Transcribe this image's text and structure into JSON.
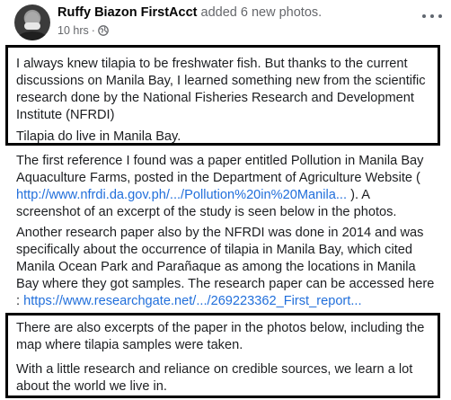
{
  "post": {
    "author_name": "Ruffy Biazon FirstAcct",
    "action": "added 6 new photos.",
    "time": "10 hrs",
    "dot": "·",
    "more_icon": "more-horizontal-icon",
    "privacy_icon": "globe-icon"
  },
  "body": {
    "p1": "I always knew tilapia to be freshwater fish. But thanks to the current discussions on Manila Bay, I learned something new from the scientific research done by the National Fisheries Research and Development Institute (NFRDI)",
    "p2": "Tilapia do live in Manila Bay.",
    "p3_before": "The first reference I found was a paper entitled Pollution in Manila Bay Aquaculture Farms, posted in the Department of Agriculture Website ( ",
    "p3_link": "http://www.nfrdi.da.gov.ph/.../Pollution%20in%20Manila...",
    "p3_after": " ). A screenshot of an excerpt of the study is seen below in the photos.",
    "p4_before": "Another research paper also by the NFRDI was done in 2014 and was specifically about the occurrence of tilapia in Manila Bay, which cited Manila Ocean Park and Parañaque as among the locations in Manila Bay where they got samples. The research paper can be accessed here : ",
    "p4_link": "https://www.researchgate.net/.../269223362_First_report...",
    "p5": "There are also excerpts of the paper in the photos below, including the map where tilapia samples were taken.",
    "p6": "With a little research and reliance on credible sources, we learn a lot about the world we live in."
  },
  "colors": {
    "link": "#216fdb",
    "secondary_text": "#65676b",
    "box_border": "#000000"
  }
}
